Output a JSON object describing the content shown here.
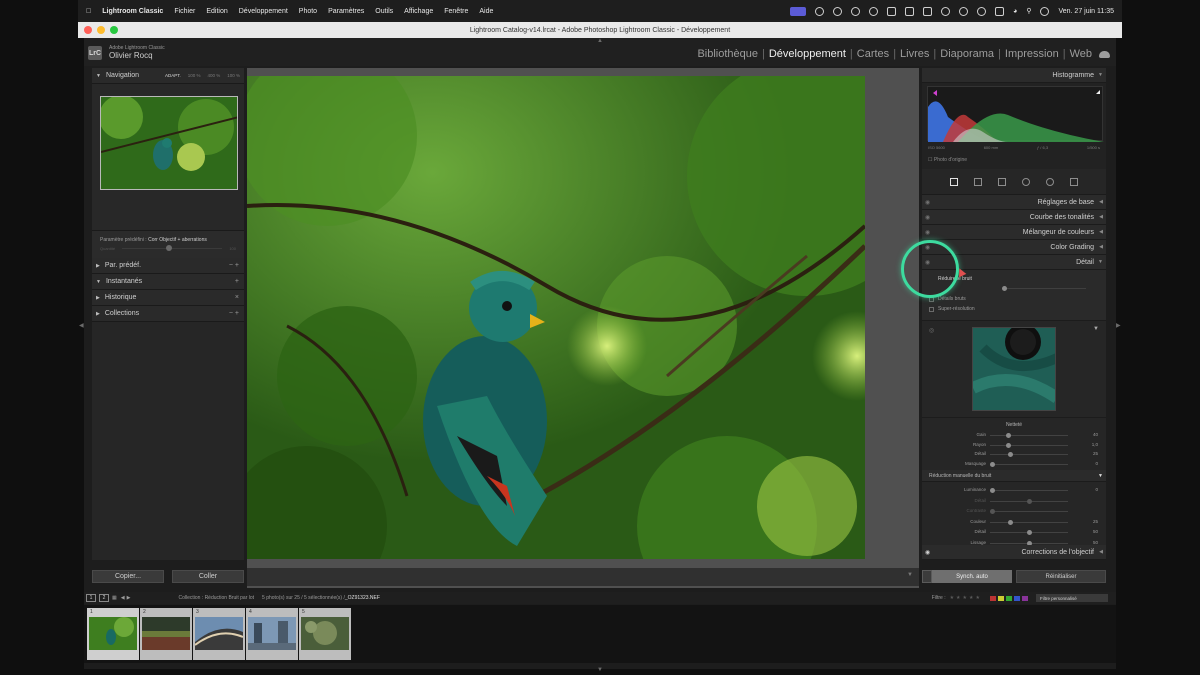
{
  "menubar": {
    "app": "Lightroom Classic",
    "items": [
      "Fichier",
      "Edition",
      "Développement",
      "Photo",
      "Paramètres",
      "Outils",
      "Affichage",
      "Fenêtre",
      "Aide"
    ],
    "datetime": "Ven. 27 juin  11:35"
  },
  "window": {
    "title": "Lightroom Catalog-v14.lrcat - Adobe Photoshop Lightroom Classic - Développement"
  },
  "identity": {
    "logo": "LrC",
    "app_name": "Adobe Lightroom Classic",
    "user": "Olivier Rocq"
  },
  "modules": [
    {
      "label": "Bibliothèque",
      "active": false
    },
    {
      "label": "Développement",
      "active": true
    },
    {
      "label": "Cartes",
      "active": false
    },
    {
      "label": "Livres",
      "active": false
    },
    {
      "label": "Diaporama",
      "active": false
    },
    {
      "label": "Impression",
      "active": false
    },
    {
      "label": "Web",
      "active": false
    }
  ],
  "left_panel": {
    "navigator": {
      "title": "Navigation",
      "zooms": [
        "ADAPT.",
        "100 %",
        "400 %",
        "100 %"
      ]
    },
    "preset": {
      "label": "Paramètre prédéfini :",
      "value": "Corr Objectif + aberrations",
      "amount_label": "Quantité",
      "amount_value": "100"
    },
    "sections": [
      {
        "label": "Par. prédéf.",
        "controls": "− +",
        "collapsed": true
      },
      {
        "label": "Instantanés",
        "controls": "+",
        "collapsed": false
      },
      {
        "label": "Historique",
        "controls": "×",
        "collapsed": true
      },
      {
        "label": "Collections",
        "controls": "− +",
        "collapsed": true
      }
    ],
    "copy_label": "Copier...",
    "paste_label": "Coller"
  },
  "right_panel": {
    "histogram": {
      "title": "Histogramme",
      "iso": "ISO 5600",
      "shutter": "600 mm",
      "aperture": "ƒ / 6,3",
      "speed": "1/500 s",
      "original": "Photo d'origine"
    },
    "sections": {
      "basic": "Réglages de base",
      "tone_curve": "Courbe des tonalités",
      "mixer": "Mélangeur de couleurs",
      "grading": "Color Grading",
      "detail": "Détail",
      "lens": "Corrections de l'objectif"
    },
    "detail": {
      "denoise": "Réduire le bruit",
      "raw_details": "Détails bruts",
      "super_res": "Super-résolution"
    },
    "sharpening": {
      "title": "Netteté",
      "rows": [
        {
          "label": "Gain",
          "value": "40",
          "knob": 0.23,
          "dim": false
        },
        {
          "label": "Rayon",
          "value": "1,0",
          "knob": 0.23,
          "dim": false
        },
        {
          "label": "Détail",
          "value": "25",
          "knob": 0.25,
          "dim": false
        },
        {
          "label": "Masquage",
          "value": "0",
          "knob": 0.02,
          "dim": false
        }
      ]
    },
    "manual_nr": {
      "title": "Réduction manuelle du bruit",
      "rows": [
        {
          "label": "Luminance",
          "value": "0",
          "knob": 0.02,
          "dim": false
        },
        {
          "label": "Détail",
          "value": "",
          "knob": 0.5,
          "dim": true
        },
        {
          "label": "Contraste",
          "value": "",
          "knob": 0.02,
          "dim": true
        },
        {
          "label": "Couleur",
          "value": "25",
          "knob": 0.25,
          "dim": false
        },
        {
          "label": "Détail",
          "value": "50",
          "knob": 0.5,
          "dim": false
        },
        {
          "label": "Lissage",
          "value": "50",
          "knob": 0.5,
          "dim": false
        }
      ]
    },
    "sync_label": "Synch. auto",
    "reset_label": "Réinitialiser"
  },
  "filmstrip": {
    "screens": [
      "1",
      "2"
    ],
    "collection": "Collection : Réduction Bruit par lot",
    "selection": "5 photo(s) sur 25 / 5 sélectionnée(s) / ",
    "filename": "_OZ91323.NEF",
    "filter_label": "Filtre :",
    "stars": "★★★★★",
    "filter_value": "Filtre personnalisé",
    "items": [
      "1",
      "2",
      "3",
      "4",
      "5"
    ]
  },
  "colors": {
    "accent_ring": "#3ddb9f",
    "sync_button": "#6f6f6f",
    "swatch_colors": [
      "#b33",
      "#cc3",
      "#3a3",
      "#35c",
      "#839"
    ]
  },
  "icons": [
    "apple-icon",
    "wifi-icon",
    "battery-icon",
    "search-icon",
    "cloud-icon",
    "eye-icon"
  ]
}
